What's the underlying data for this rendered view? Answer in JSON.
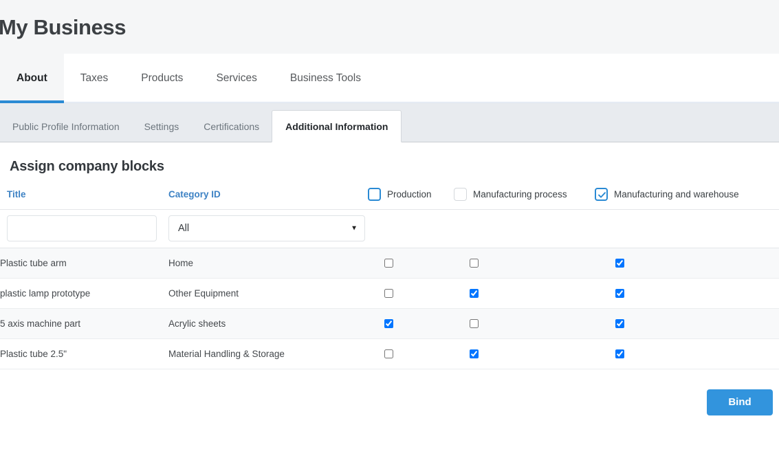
{
  "header": {
    "title": "My Business",
    "background": "#f5f6f7"
  },
  "primary_tabs": [
    {
      "label": "About",
      "active": true
    },
    {
      "label": "Taxes",
      "active": false
    },
    {
      "label": "Products",
      "active": false
    },
    {
      "label": "Services",
      "active": false
    },
    {
      "label": "Business Tools",
      "active": false
    }
  ],
  "sub_tabs": [
    {
      "label": "Public Profile Information",
      "active": false
    },
    {
      "label": "Settings",
      "active": false
    },
    {
      "label": "Certifications",
      "active": false
    },
    {
      "label": "Additional Information",
      "active": true
    }
  ],
  "section": {
    "title": "Assign company blocks"
  },
  "table": {
    "columns": {
      "title": "Title",
      "category": "Category ID",
      "production": "Production",
      "manufacturing_process": "Manufacturing process",
      "manufacturing_warehouse": "Manufacturing and warehouse"
    },
    "header_checkboxes": [
      {
        "name": "production",
        "label": "Production",
        "checked": false,
        "style": "accent"
      },
      {
        "name": "manufacturing-process",
        "label": "Manufacturing process",
        "checked": false,
        "style": "muted"
      },
      {
        "name": "manufacturing-and-warehouse",
        "label": "Manufacturing and warehouse",
        "checked": true,
        "style": "accent"
      }
    ],
    "filters": {
      "title_value": "",
      "title_placeholder": "",
      "category_value": "All",
      "category_options": [
        "All"
      ]
    },
    "rows": [
      {
        "title": "Plastic tube arm",
        "category": "Home",
        "production": false,
        "process": false,
        "warehouse": true
      },
      {
        "title": "plastic lamp prototype",
        "category": "Other Equipment",
        "production": false,
        "process": true,
        "warehouse": true
      },
      {
        "title": "5 axis machine part",
        "category": "Acrylic sheets",
        "production": true,
        "process": false,
        "warehouse": true
      },
      {
        "title": "Plastic tube 2.5\"",
        "category": "Material Handling & Storage",
        "production": false,
        "process": true,
        "warehouse": true
      }
    ]
  },
  "footer": {
    "bind_label": "Bind"
  },
  "colors": {
    "accent": "#2a8ad4",
    "button": "#3294dd",
    "link": "#3d82c4",
    "header_bg": "#f5f6f7",
    "subtab_bg": "#e8ebef",
    "row_stripe": "#f8f9fa"
  }
}
